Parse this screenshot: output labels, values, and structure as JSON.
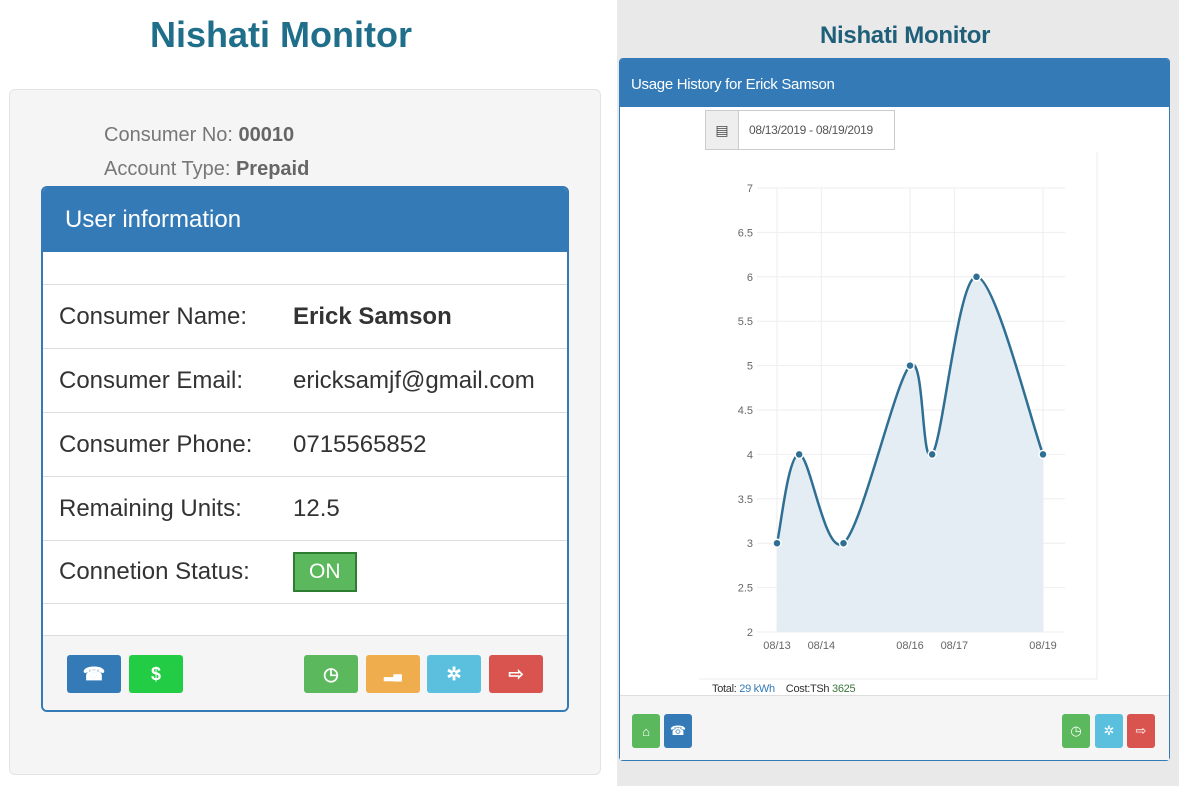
{
  "left": {
    "app_title": "Nishati Monitor",
    "consumer_no_label": "Consumer No:",
    "consumer_no": "00010",
    "account_type_label": "Account Type:",
    "account_type": "Prepaid",
    "panel_title": "User information",
    "rows": [
      {
        "label": "Consumer Name:",
        "value": "Erick Samson"
      },
      {
        "label": "Consumer Email:",
        "value": "ericksamjf@gmail.com"
      },
      {
        "label": "Consumer Phone:",
        "value": "0715565852"
      },
      {
        "label": "Remaining Units:",
        "value": "12.5"
      },
      {
        "label": "Connetion Status:",
        "value": "ON"
      }
    ],
    "footer_buttons": [
      {
        "icon": "phone-icon",
        "glyph": "☎",
        "color": "#337ab7"
      },
      {
        "icon": "dollar-icon",
        "glyph": "$",
        "color": "#22cc44"
      },
      {
        "icon": "clock-icon",
        "glyph": "◷",
        "color": "#5cb85c"
      },
      {
        "icon": "signal-icon",
        "glyph": "▂▄",
        "color": "#f0ad4e"
      },
      {
        "icon": "gear-icon",
        "glyph": "✲",
        "color": "#5bc0de"
      },
      {
        "icon": "logout-icon",
        "glyph": "⇨",
        "color": "#d9534f"
      }
    ]
  },
  "right": {
    "app_title": "Nishati Monitor",
    "panel_title": "Usage History for Erick Samson",
    "date_range": "08/13/2019 - 08/19/2019",
    "total_label": "Total:",
    "total_value": "29 kWh",
    "cost_label": "Cost:TSh",
    "cost_value": "3625",
    "footer_buttons": [
      {
        "icon": "home-icon",
        "glyph": "⌂",
        "color": "#5cb85c"
      },
      {
        "icon": "phone-icon",
        "glyph": "☎",
        "color": "#337ab7"
      },
      {
        "icon": "clock-icon",
        "glyph": "◷",
        "color": "#5cb85c"
      },
      {
        "icon": "gear-icon",
        "glyph": "✲",
        "color": "#5bc0de"
      },
      {
        "icon": "logout-icon",
        "glyph": "⇨",
        "color": "#d9534f"
      }
    ]
  },
  "chart_data": {
    "type": "area",
    "x": [
      "08/13",
      "08/13 12:00",
      "08/14 12:00",
      "08/16",
      "08/16 12:00",
      "08/17 12:00",
      "08/19"
    ],
    "x_ticks": [
      "08/13",
      "08/14",
      "08/16",
      "08/17",
      "08/19"
    ],
    "values": [
      3,
      4,
      3,
      5,
      4,
      6,
      4
    ],
    "ylim": [
      2,
      7
    ],
    "y_ticks": [
      "2",
      "2.5",
      "3",
      "3.5",
      "4",
      "4.5",
      "5",
      "5.5",
      "6",
      "6.5",
      "7"
    ],
    "grid": true,
    "line_color": "#2f6f94",
    "fill_color": "#e4edf3"
  }
}
